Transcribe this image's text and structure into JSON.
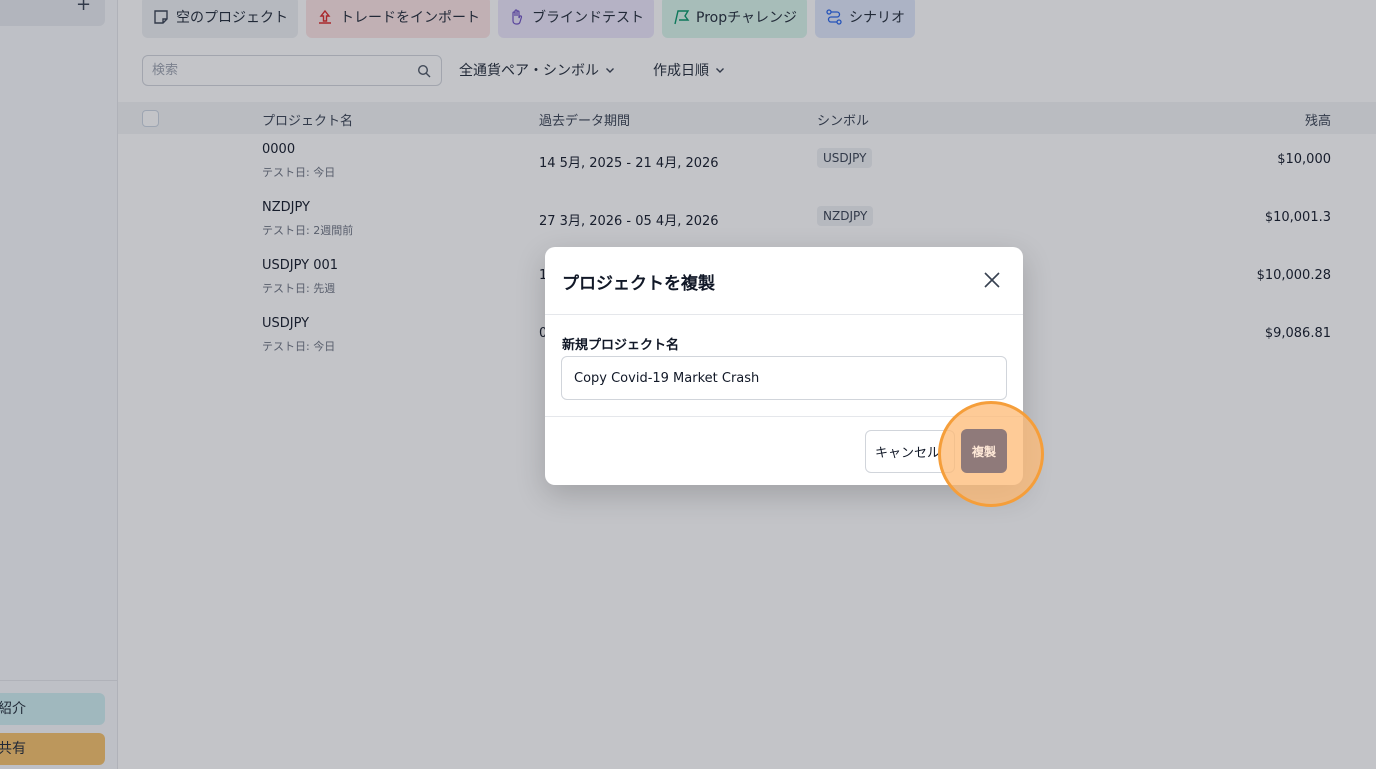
{
  "sidebar": {
    "top_plus": "+",
    "intro_button": "紹介",
    "share_button": "共有"
  },
  "toolbar": {
    "buttons": [
      {
        "label": "空のプロジェクト",
        "icon": "blank-note-icon"
      },
      {
        "label": "トレードをインポート",
        "icon": "upload-icon"
      },
      {
        "label": "ブラインドテスト",
        "icon": "hand-icon"
      },
      {
        "label": "Propチャレンジ",
        "icon": "flag-icon"
      },
      {
        "label": "シナリオ",
        "icon": "route-icon"
      }
    ]
  },
  "filters": {
    "search_placeholder": "検索",
    "pair_filter": "全通貨ペア・シンボル",
    "sort": "作成日順"
  },
  "table": {
    "columns": [
      "プロジェクト名",
      "過去データ期間",
      "シンボル",
      "残高"
    ],
    "rows": [
      {
        "name": "0000",
        "sub": "テスト日: 今日",
        "period": "14 5月, 2025 - 21 4月, 2026",
        "symbol": "USDJPY",
        "balance": "$10,000"
      },
      {
        "name": "NZDJPY",
        "sub": "テスト日: 2週間前",
        "period": "27 3月, 2026 - 05 4月, 2026",
        "symbol": "NZDJPY",
        "balance": "$10,001.3"
      },
      {
        "name": "USDJPY 001",
        "sub": "テスト日: 先週",
        "period": "1",
        "symbol": "",
        "balance": "$10,000.28"
      },
      {
        "name": "USDJPY",
        "sub": "テスト日: 今日",
        "period": "0",
        "symbol": "",
        "balance": "$9,086.81"
      }
    ]
  },
  "dialog": {
    "title": "プロジェクトを複製",
    "field_label": "新規プロジェクト名",
    "field_value": "Copy Covid-19 Market Crash",
    "cancel_label": "キャンセル",
    "duplicate_label": "複製"
  },
  "colors": {
    "overlay": "#282c38",
    "highlight_ring": "#f59e3a",
    "duplicate_button": "#8f7a7a"
  }
}
